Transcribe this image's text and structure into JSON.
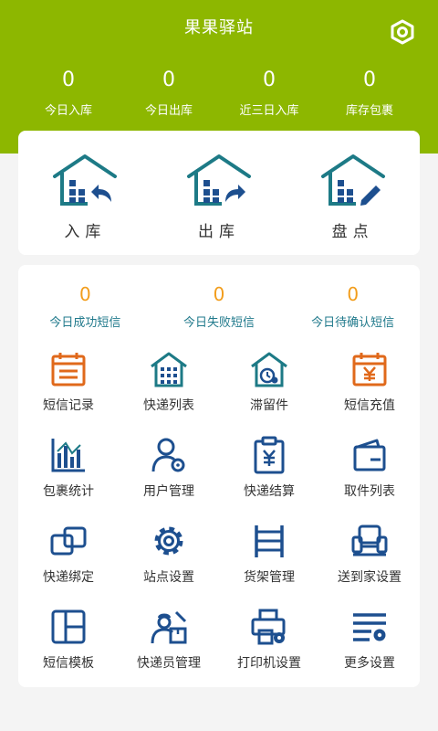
{
  "header": {
    "title": "果果驿站"
  },
  "stats": [
    {
      "value": "0",
      "label": "今日入库"
    },
    {
      "value": "0",
      "label": "今日出库"
    },
    {
      "value": "0",
      "label": "近三日入库"
    },
    {
      "value": "0",
      "label": "库存包裹"
    }
  ],
  "main_actions": [
    {
      "label": "入库",
      "icon": "warehouse-in-icon"
    },
    {
      "label": "出库",
      "icon": "warehouse-out-icon"
    },
    {
      "label": "盘点",
      "icon": "warehouse-check-icon"
    }
  ],
  "sms_stats": [
    {
      "value": "0",
      "label": "今日成功短信"
    },
    {
      "value": "0",
      "label": "今日失败短信"
    },
    {
      "value": "0",
      "label": "今日待确认短信"
    }
  ],
  "grid": [
    {
      "label": "短信记录",
      "icon": "calendar-icon"
    },
    {
      "label": "快递列表",
      "icon": "building-icon"
    },
    {
      "label": "滞留件",
      "icon": "clock-house-icon"
    },
    {
      "label": "短信充值",
      "icon": "yuan-calendar-icon"
    },
    {
      "label": "包裹统计",
      "icon": "bar-chart-icon"
    },
    {
      "label": "用户管理",
      "icon": "user-gear-icon"
    },
    {
      "label": "快递结算",
      "icon": "clipboard-yuan-icon"
    },
    {
      "label": "取件列表",
      "icon": "wallet-icon"
    },
    {
      "label": "快递绑定",
      "icon": "link-squares-icon"
    },
    {
      "label": "站点设置",
      "icon": "gear-icon"
    },
    {
      "label": "货架管理",
      "icon": "shelf-icon"
    },
    {
      "label": "送到家设置",
      "icon": "sofa-icon"
    },
    {
      "label": "短信模板",
      "icon": "template-icon"
    },
    {
      "label": "快递员管理",
      "icon": "courier-icon"
    },
    {
      "label": "打印机设置",
      "icon": "printer-gear-icon"
    },
    {
      "label": "更多设置",
      "icon": "list-gear-icon"
    }
  ],
  "colors": {
    "header": "#8db700",
    "teal": "#1d7a86",
    "blue": "#1d4f8f",
    "orange": "#e0691b",
    "sms_value": "#f29d1c"
  }
}
